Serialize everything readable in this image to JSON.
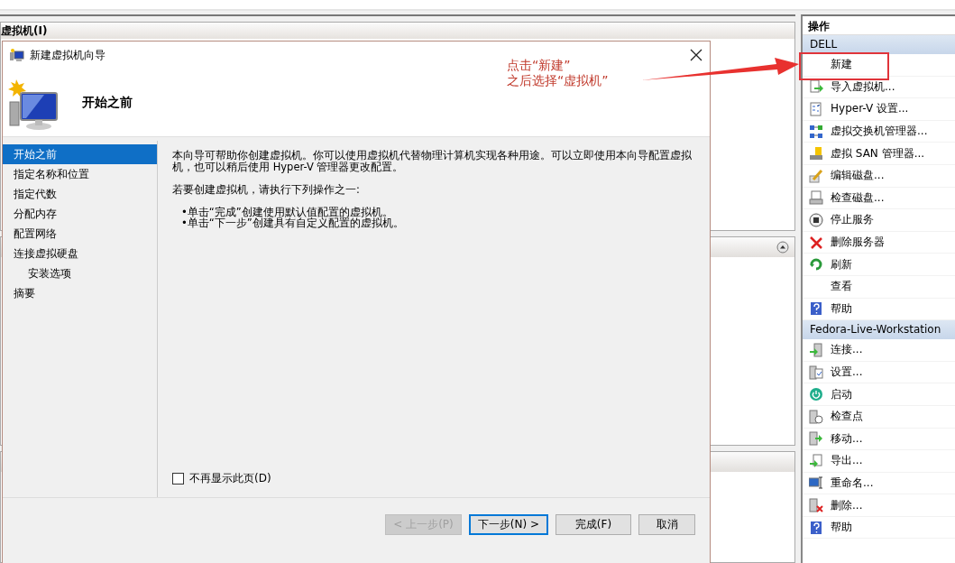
{
  "vm_panel": {
    "title": "虚拟机(I)"
  },
  "actions": {
    "title": "操作",
    "sections": [
      {
        "title": "DELL",
        "items": [
          {
            "label": "新建"
          },
          {
            "label": "导入虚拟机..."
          },
          {
            "label": "Hyper-V 设置..."
          },
          {
            "label": "虚拟交换机管理器..."
          },
          {
            "label": "虚拟 SAN 管理器..."
          },
          {
            "label": "编辑磁盘..."
          },
          {
            "label": "检查磁盘..."
          },
          {
            "label": "停止服务"
          },
          {
            "label": "删除服务器"
          },
          {
            "label": "刷新"
          },
          {
            "label": "查看"
          },
          {
            "label": "帮助"
          }
        ]
      },
      {
        "title": "Fedora-Live-Workstation",
        "items": [
          {
            "label": "连接..."
          },
          {
            "label": "设置..."
          },
          {
            "label": "启动"
          },
          {
            "label": "检查点"
          },
          {
            "label": "移动..."
          },
          {
            "label": "导出..."
          },
          {
            "label": "重命名..."
          },
          {
            "label": "删除..."
          },
          {
            "label": "帮助"
          }
        ]
      }
    ]
  },
  "annotation": {
    "lines": [
      "点击“新建”",
      "之后选择“虚拟机”"
    ]
  },
  "dialog": {
    "title": "新建虚拟机向导",
    "heading": "开始之前",
    "steps": [
      {
        "label": "开始之前",
        "selected": true
      },
      {
        "label": "指定名称和位置",
        "selected": false
      },
      {
        "label": "指定代数",
        "selected": false
      },
      {
        "label": "分配内存",
        "selected": false
      },
      {
        "label": "配置网络",
        "selected": false
      },
      {
        "label": "连接虚拟硬盘",
        "selected": false,
        "children": [
          {
            "label": "安装选项",
            "selected": false
          }
        ]
      },
      {
        "label": "摘要",
        "selected": false
      }
    ],
    "intro": "本向导可帮助你创建虚拟机。你可以使用虚拟机代替物理计算机实现各种用途。可以立即使用本向导配置虚拟机，也可以稍后使用 Hyper-V 管理器更改配置。",
    "instruction": "若要创建虚拟机，请执行下列操作之一:",
    "bullets": [
      "•单击“完成”创建使用默认值配置的虚拟机。",
      "•单击“下一步”创建具有自定义配置的虚拟机。"
    ],
    "dont_show": {
      "label": "不再显示此页(D)",
      "checked": false
    },
    "buttons": [
      {
        "label": "< 上一步(P)",
        "disabled": true,
        "focused": false
      },
      {
        "label": "下一步(N) >",
        "disabled": false,
        "focused": true
      },
      {
        "label": "完成(F)",
        "disabled": false,
        "focused": false
      },
      {
        "label": "取消",
        "disabled": false,
        "focused": false
      }
    ]
  }
}
